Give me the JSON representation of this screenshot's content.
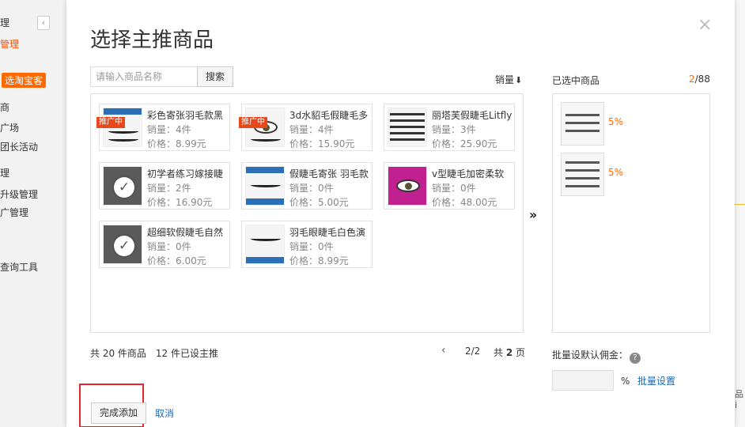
{
  "background": {
    "sidebar_items": [
      {
        "label": "理",
        "style": "plain"
      },
      {
        "label": "管理",
        "style": "orange"
      },
      {
        "label": "选淘宝客",
        "style": "tag"
      },
      {
        "label": "商",
        "style": "plain"
      },
      {
        "label": "广场",
        "style": "plain"
      },
      {
        "label": "团长活动",
        "style": "plain"
      },
      {
        "label": "理",
        "style": "plain"
      },
      {
        "label": "升级管理",
        "style": "plain"
      },
      {
        "label": "广管理",
        "style": "plain"
      },
      {
        "label": "查询工具",
        "style": "plain"
      }
    ],
    "collapse_icon": "‹",
    "right_edge_text": "品i"
  },
  "modal": {
    "title": "选择主推商品",
    "close_icon": "×",
    "search": {
      "placeholder": "请输入商品名称",
      "button_label": "搜索"
    },
    "sort": {
      "label": "销量",
      "arrow": "⬇"
    },
    "products": [
      {
        "name": "彩色寄张羽毛款黑",
        "sales_label": "销量：",
        "sales": "4件",
        "price_label": "价格：",
        "price": "8.99元",
        "promo": "推广中",
        "selected": false
      },
      {
        "name": "3d水貂毛假睫毛多",
        "sales_label": "销量：",
        "sales": "4件",
        "price_label": "价格：",
        "price": "15.90元",
        "promo": "推广中",
        "selected": false
      },
      {
        "name": "丽塔芙假睫毛Litfly",
        "sales_label": "销量：",
        "sales": "3件",
        "price_label": "价格：",
        "price": "25.90元",
        "promo": "",
        "selected": false
      },
      {
        "name": "初学者练习嫁接睫",
        "sales_label": "销量：",
        "sales": "2件",
        "price_label": "价格：",
        "price": "16.90元",
        "promo": "",
        "selected": true
      },
      {
        "name": "假睫毛寄张 羽毛款",
        "sales_label": "销量：",
        "sales": "0件",
        "price_label": "价格：",
        "price": "5.00元",
        "promo": "",
        "selected": false
      },
      {
        "name": "v型睫毛加密柔软",
        "sales_label": "销量：",
        "sales": "0件",
        "price_label": "价格：",
        "price": "48.00元",
        "promo": "",
        "selected": false
      },
      {
        "name": "超细软假睫毛自然",
        "sales_label": "销量：",
        "sales": "0件",
        "price_label": "价格：",
        "price": "6.00元",
        "promo": "",
        "selected": true
      },
      {
        "name": "羽毛眼睫毛白色演",
        "sales_label": "销量：",
        "sales": "0件",
        "price_label": "价格：",
        "price": "8.99元",
        "promo": "",
        "selected": false
      }
    ],
    "move_arrow": "››",
    "selected": {
      "label": "已选中商品",
      "count_current": "2",
      "count_total": "/88",
      "items": [
        {
          "commission": "5%"
        },
        {
          "commission": "5%"
        }
      ]
    },
    "footer": {
      "total_text": "共 20 件商品",
      "featured_text": "12 件已设主推",
      "prev_icon": "‹",
      "page_indicator": "2/2",
      "total_pages_prefix": "共 ",
      "total_pages_num": "2",
      "total_pages_suffix": " 页"
    },
    "commission": {
      "label": "批量设默认佣金：",
      "help_icon": "?",
      "unit": "%",
      "batch_link": "批量设置"
    },
    "actions": {
      "finish_label": "完成添加",
      "cancel_label": "取消"
    }
  },
  "colors": {
    "accent": "#ff6a00",
    "link": "#1a6ab8",
    "promo": "#e8491c",
    "highlight": "#e5252b"
  }
}
